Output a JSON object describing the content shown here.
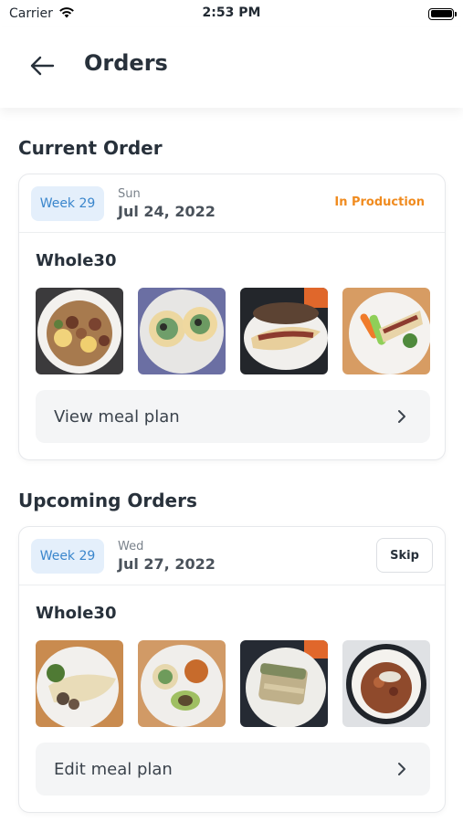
{
  "status_bar": {
    "carrier": "Carrier",
    "time": "2:53 PM"
  },
  "header": {
    "title": "Orders",
    "back_icon": "arrow-left-icon"
  },
  "current": {
    "section_title": "Current Order",
    "week": "Week 29",
    "day": "Sun",
    "date": "Jul 24, 2022",
    "status": "In Production",
    "status_color": "#f08b1f",
    "plan_name": "Whole30",
    "action_label": "View meal plan"
  },
  "upcoming": {
    "section_title": "Upcoming Orders",
    "week": "Week 29",
    "day": "Wed",
    "date": "Jul 27, 2022",
    "skip_label": "Skip",
    "plan_name": "Whole30",
    "action_label": "Edit meal plan"
  },
  "colors": {
    "accent_blue": "#3a86cc",
    "badge_bg": "#e4effb",
    "status_orange": "#f08b1f"
  }
}
